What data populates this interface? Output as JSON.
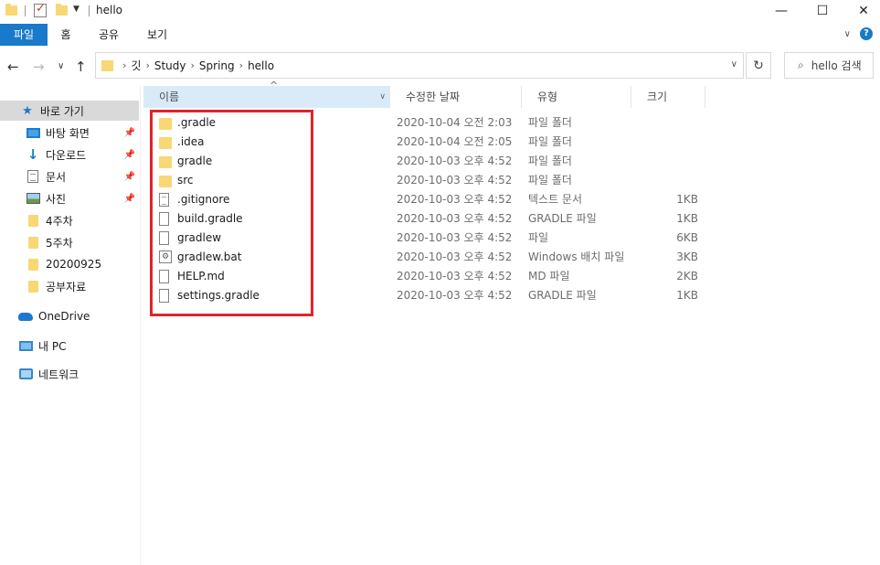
{
  "window": {
    "title": "hello",
    "minimize_icon": "minimize-icon",
    "maximize_icon": "maximize-icon",
    "close_icon": "close-icon"
  },
  "ribbon": {
    "tabs": [
      {
        "label": "파일"
      },
      {
        "label": "홈"
      },
      {
        "label": "공유"
      },
      {
        "label": "보기"
      }
    ],
    "help_label": "?"
  },
  "nav": {
    "breadcrumbs": [
      "깃",
      "Study",
      "Spring",
      "hello"
    ],
    "search_placeholder": "hello 검색"
  },
  "sidebar": {
    "items": [
      {
        "label": "바로 가기",
        "icon": "star-icon"
      },
      {
        "label": "바탕 화면",
        "icon": "desktop-icon"
      },
      {
        "label": "다운로드",
        "icon": "download-icon"
      },
      {
        "label": "문서",
        "icon": "documents-icon"
      },
      {
        "label": "사진",
        "icon": "pictures-icon"
      },
      {
        "label": "4주차",
        "icon": "folder-icon"
      },
      {
        "label": "5주차",
        "icon": "folder-icon"
      },
      {
        "label": "20200925",
        "icon": "folder-icon"
      },
      {
        "label": "공부자료",
        "icon": "folder-icon"
      },
      {
        "label": "OneDrive",
        "icon": "onedrive-icon"
      },
      {
        "label": "내 PC",
        "icon": "pc-icon"
      },
      {
        "label": "네트워크",
        "icon": "network-icon"
      }
    ]
  },
  "columns": {
    "name": "이름",
    "date": "수정한 날짜",
    "type": "유형",
    "size": "크기"
  },
  "files": [
    {
      "name": ".gradle",
      "date": "2020-10-04 오전 2:03",
      "type": "파일 폴더",
      "size": "",
      "icon": "folder-icon"
    },
    {
      "name": ".idea",
      "date": "2020-10-04 오전 2:05",
      "type": "파일 폴더",
      "size": "",
      "icon": "folder-icon"
    },
    {
      "name": "gradle",
      "date": "2020-10-03 오후 4:52",
      "type": "파일 폴더",
      "size": "",
      "icon": "folder-icon"
    },
    {
      "name": "src",
      "date": "2020-10-03 오후 4:52",
      "type": "파일 폴더",
      "size": "",
      "icon": "folder-icon"
    },
    {
      "name": ".gitignore",
      "date": "2020-10-03 오후 4:52",
      "type": "텍스트 문서",
      "size": "1KB",
      "icon": "text-file-icon"
    },
    {
      "name": "build.gradle",
      "date": "2020-10-03 오후 4:52",
      "type": "GRADLE 파일",
      "size": "1KB",
      "icon": "file-icon"
    },
    {
      "name": "gradlew",
      "date": "2020-10-03 오후 4:52",
      "type": "파일",
      "size": "6KB",
      "icon": "file-icon"
    },
    {
      "name": "gradlew.bat",
      "date": "2020-10-03 오후 4:52",
      "type": "Windows 배치 파일",
      "size": "3KB",
      "icon": "batch-file-icon"
    },
    {
      "name": "HELP.md",
      "date": "2020-10-03 오후 4:52",
      "type": "MD 파일",
      "size": "2KB",
      "icon": "file-icon"
    },
    {
      "name": "settings.gradle",
      "date": "2020-10-03 오후 4:52",
      "type": "GRADLE 파일",
      "size": "1KB",
      "icon": "file-icon"
    }
  ],
  "colors": {
    "accent": "#1979ca",
    "highlight_box": "#e0242a",
    "folder": "#f8d775",
    "selected_sidebar": "#d9d9d9"
  }
}
